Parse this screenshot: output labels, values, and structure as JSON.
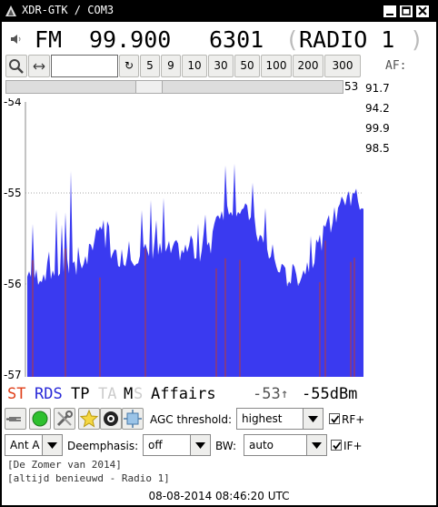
{
  "window": {
    "title": "XDR-GTK / COM3"
  },
  "tuner": {
    "band": "FM",
    "frequency": "99.900",
    "pi_code": "6301",
    "paren_open": "(",
    "ps_name": "RADIO 1",
    "paren_close": ")"
  },
  "toolbar": {
    "search_icon": "magnifier-icon",
    "swap_icon": "left-right-arrow-icon",
    "freq_input_value": "",
    "reset_label": "↻",
    "steps": [
      "5",
      "9",
      "10",
      "30",
      "50",
      "100",
      "200",
      "300"
    ],
    "af_label": "AF:"
  },
  "signal": {
    "value_label": "53",
    "level": 53
  },
  "af_list": [
    "91.7",
    "94.2",
    "99.9",
    "98.5"
  ],
  "graph": {
    "y_ticks": [
      "-54",
      "-55",
      "-56",
      "-57"
    ],
    "fill_color": "#3a3af0",
    "marker_color": "#c0392b",
    "background": "#ffffff"
  },
  "rds": {
    "st": "ST",
    "rds": "RDS",
    "tp": "TP",
    "ta": "TA",
    "m": "M",
    "s": "S",
    "pty": "Affairs",
    "signal_short": "-53",
    "signal_arrow": "↑",
    "signal_dbm": "-55dBm",
    "st_color": "#e0401a",
    "rds_color": "#2a2ad8",
    "disabled_color": "#cccccc"
  },
  "controls": {
    "agc_label": "AGC threshold:",
    "agc_value": "highest",
    "rf_label": "RF+",
    "rf_checked": true,
    "antenna_value": "Ant A",
    "deemph_label": "Deemphasis:",
    "deemph_value": "off",
    "bw_label": "BW:",
    "bw_value": "auto",
    "if_label": "IF+",
    "if_checked": true
  },
  "radiotext": {
    "line1": "[De Zomer van 2014]",
    "line2": "[altijd benieuwd - Radio 1]"
  },
  "clock": "08-08-2014 08:46:20 UTC"
}
